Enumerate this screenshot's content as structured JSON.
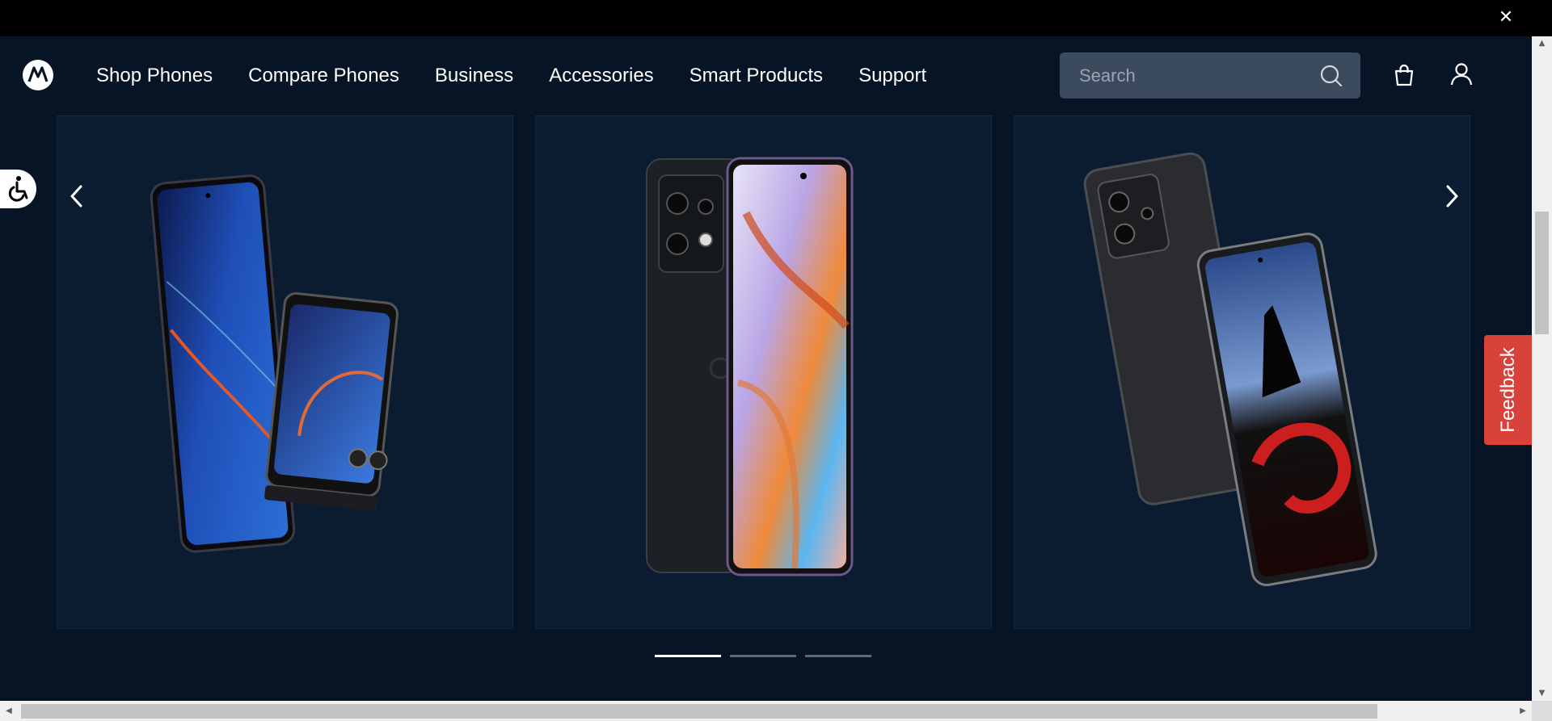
{
  "window": {
    "close_label": "✕"
  },
  "nav": {
    "logo": "motorola-logo",
    "links": [
      {
        "label": "Shop Phones"
      },
      {
        "label": "Compare Phones"
      },
      {
        "label": "Business"
      },
      {
        "label": "Accessories"
      },
      {
        "label": "Smart Products"
      },
      {
        "label": "Support"
      }
    ],
    "search": {
      "placeholder": "Search",
      "value": ""
    }
  },
  "carousel": {
    "slides": [
      {
        "image": "razr-flip-phone-image"
      },
      {
        "image": "edge-phone-image"
      },
      {
        "image": "thinkphone-image"
      }
    ],
    "active_index": 0,
    "total": 3
  },
  "feedback": {
    "label": "Feedback"
  },
  "colors": {
    "background": "#061426",
    "card": "#0b1c30",
    "feedback": "#d9423a",
    "search_bg": "#3b4a5c"
  }
}
